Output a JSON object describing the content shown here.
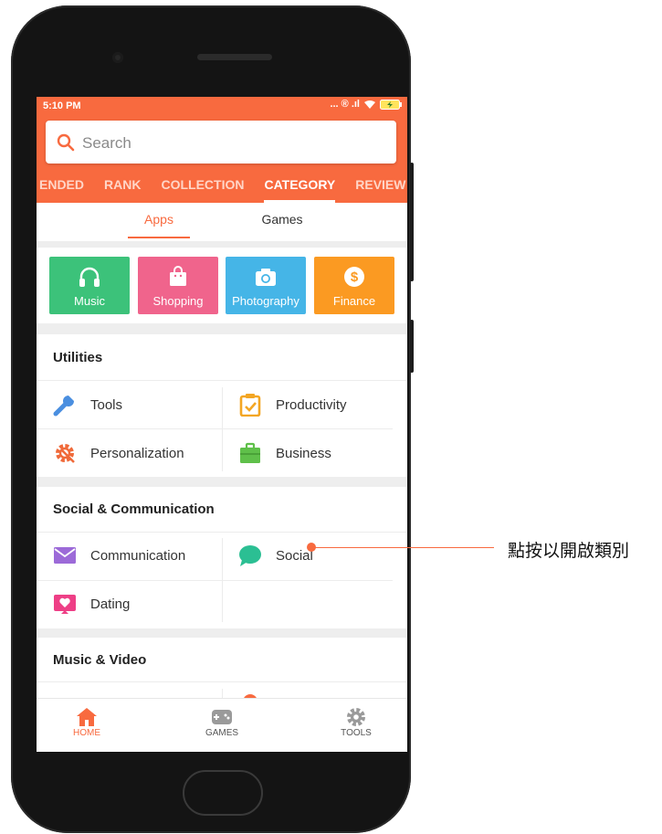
{
  "status_bar": {
    "time": "5:10 PM",
    "indicators": "... ® .ıl"
  },
  "search": {
    "placeholder": "Search"
  },
  "tabs": [
    {
      "label": "ENDED"
    },
    {
      "label": "RANK"
    },
    {
      "label": "COLLECTION"
    },
    {
      "label": "CATEGORY",
      "active": true
    },
    {
      "label": "REVIEW"
    }
  ],
  "subtabs": {
    "apps": "Apps",
    "games": "Games"
  },
  "featured": [
    {
      "label": "Music",
      "color": "#3cc27a",
      "icon": "headphones-icon"
    },
    {
      "label": "Shopping",
      "color": "#f0648c",
      "icon": "shopping-bag-icon"
    },
    {
      "label": "Photography",
      "color": "#45b5e7",
      "icon": "camera-icon"
    },
    {
      "label": "Finance",
      "color": "#fb9a22",
      "icon": "dollar-icon"
    }
  ],
  "sections": [
    {
      "title": "Utilities",
      "items": [
        {
          "label": "Tools",
          "icon": "wrench-icon"
        },
        {
          "label": "Productivity",
          "icon": "clipboard-check-icon"
        },
        {
          "label": "Personalization",
          "icon": "gear-brush-icon"
        },
        {
          "label": "Business",
          "icon": "briefcase-icon"
        }
      ]
    },
    {
      "title": "Social & Communication",
      "items": [
        {
          "label": "Communication",
          "icon": "envelope-icon"
        },
        {
          "label": "Social",
          "icon": "chat-bubble-icon"
        },
        {
          "label": "Dating",
          "icon": "heart-card-icon"
        }
      ]
    },
    {
      "title": "Music & Video"
    }
  ],
  "bottom_nav": {
    "home": "HOME",
    "games": "GAMES",
    "tools": "TOOLS"
  },
  "callout": {
    "text": "點按以開啟類別"
  },
  "colors": {
    "accent": "#f86a3f"
  }
}
